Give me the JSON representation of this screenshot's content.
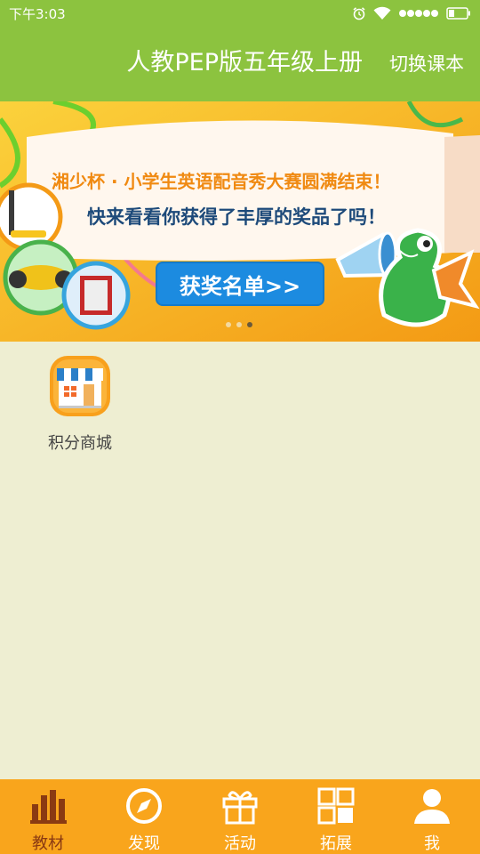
{
  "status_bar": {
    "time": "下午3:03",
    "icons": [
      "alarm-icon",
      "wifi-icon",
      "signal-icon",
      "battery-icon"
    ]
  },
  "header": {
    "title": "人教PEP版五年级上册",
    "switch_label": "切换课本"
  },
  "banner": {
    "line1": "湘少杯 · 小学生英语配音秀大赛圆满结束！",
    "line2": "快来看看你获得了丰厚的奖品了吗！",
    "cta": "获奖名单>>",
    "page_count": 3,
    "active_page": 3
  },
  "shop": {
    "label": "积分商城",
    "icon": "shop-icon"
  },
  "bottom_nav": {
    "items": [
      {
        "label": "教材",
        "icon": "bar-chart-icon",
        "active": true
      },
      {
        "label": "发现",
        "icon": "compass-icon",
        "active": false
      },
      {
        "label": "活动",
        "icon": "gift-icon",
        "active": false
      },
      {
        "label": "拓展",
        "icon": "grid-icon",
        "active": false
      },
      {
        "label": "我",
        "icon": "user-icon",
        "active": false
      }
    ]
  },
  "colors": {
    "header_bg": "#8cc33f",
    "content_bg": "#eeeed2",
    "nav_bg": "#f9a51c",
    "nav_active": "#8a3a12"
  }
}
